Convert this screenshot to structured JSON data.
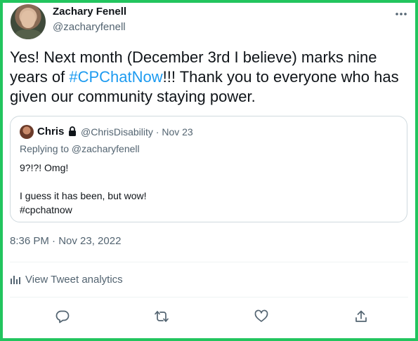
{
  "author": {
    "display_name": "Zachary Fenell",
    "handle": "@zacharyfenell"
  },
  "tweet": {
    "text_before": "Yes! Next month (December 3rd I believe) marks nine years of ",
    "hashtag": "#CPChatNow",
    "text_after": "!!! Thank you to everyone who has given our community staying power.",
    "timestamp": "8:36 PM · Nov 23, 2022"
  },
  "quote": {
    "display_name": "Chris",
    "handle_date": "@ChrisDisability · Nov 23",
    "replying_to": "Replying to @zacharyfenell",
    "lines": [
      "9?!?! Omg!",
      "",
      "I guess it has been, but wow!",
      "#cpchatnow"
    ]
  },
  "analytics": {
    "label": "View Tweet analytics"
  },
  "icons": {
    "more": "more-horizontal-icon",
    "lock": "lock-icon",
    "analytics": "bar-chart-icon",
    "reply": "reply-bubble-icon",
    "retweet": "retweet-icon",
    "like": "heart-icon",
    "share": "share-upload-icon"
  },
  "colors": {
    "frame": "#22c55e",
    "link": "#1d9bf0",
    "secondary_text": "#536471",
    "border": "#cfd9de"
  }
}
